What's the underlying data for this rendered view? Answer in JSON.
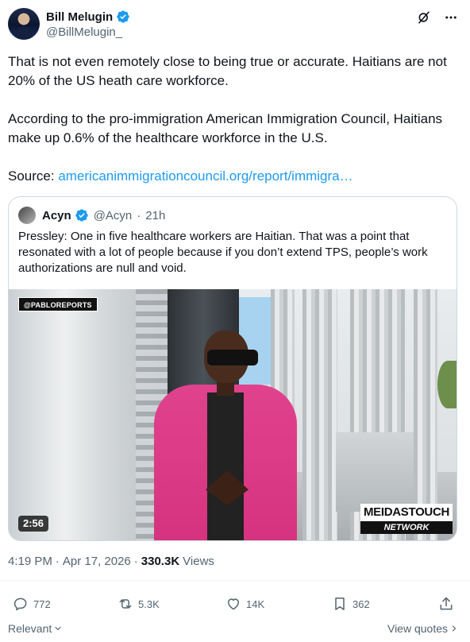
{
  "author": {
    "display_name": "Bill Melugin",
    "handle": "@BillMelugin_"
  },
  "tweet": {
    "paragraphs": [
      "That is not even remotely close to being true or accurate. Haitians are not 20% of the US heath care workforce.",
      "According to the pro-immigration American Immigration Council, Haitians make up 0.6% of the healthcare workforce in the U.S."
    ],
    "source_label": "Source:",
    "source_link": "americanimmigrationcouncil.org/report/immigra…"
  },
  "quote": {
    "name": "Acyn",
    "handle": "@Acyn",
    "separator": "·",
    "time": "21h",
    "text": "Pressley: One in five healthcare workers are Haitian. That was a point that resonated with a lot of people because if you don’t extend TPS, people’s work authorizations are null and void.",
    "video": {
      "watermark": "@PABLOREPORTS",
      "duration": "2:56",
      "logo_top": "MEIDASTOUCH",
      "logo_bottom": "NETWORK"
    }
  },
  "meta": {
    "time": "4:19 PM",
    "separator": "·",
    "date": "Apr 17, 2026",
    "separator2": "·",
    "views_count": "330.3K",
    "views_label": "Views"
  },
  "actions": {
    "replies": "772",
    "reposts": "5.3K",
    "likes": "14K",
    "bookmarks": "362"
  },
  "footer": {
    "sort_label": "Relevant",
    "view_quotes": "View quotes"
  },
  "icons": {
    "verified": "verified-badge-icon",
    "grok": "grok-icon",
    "more": "more-icon",
    "reply": "reply-icon",
    "repost": "repost-icon",
    "like": "heart-icon",
    "bookmark": "bookmark-icon",
    "share": "share-icon"
  },
  "colors": {
    "accent": "#1d9bf0",
    "text": "#0f1419",
    "muted": "#536471",
    "border": "#cfd9de"
  }
}
